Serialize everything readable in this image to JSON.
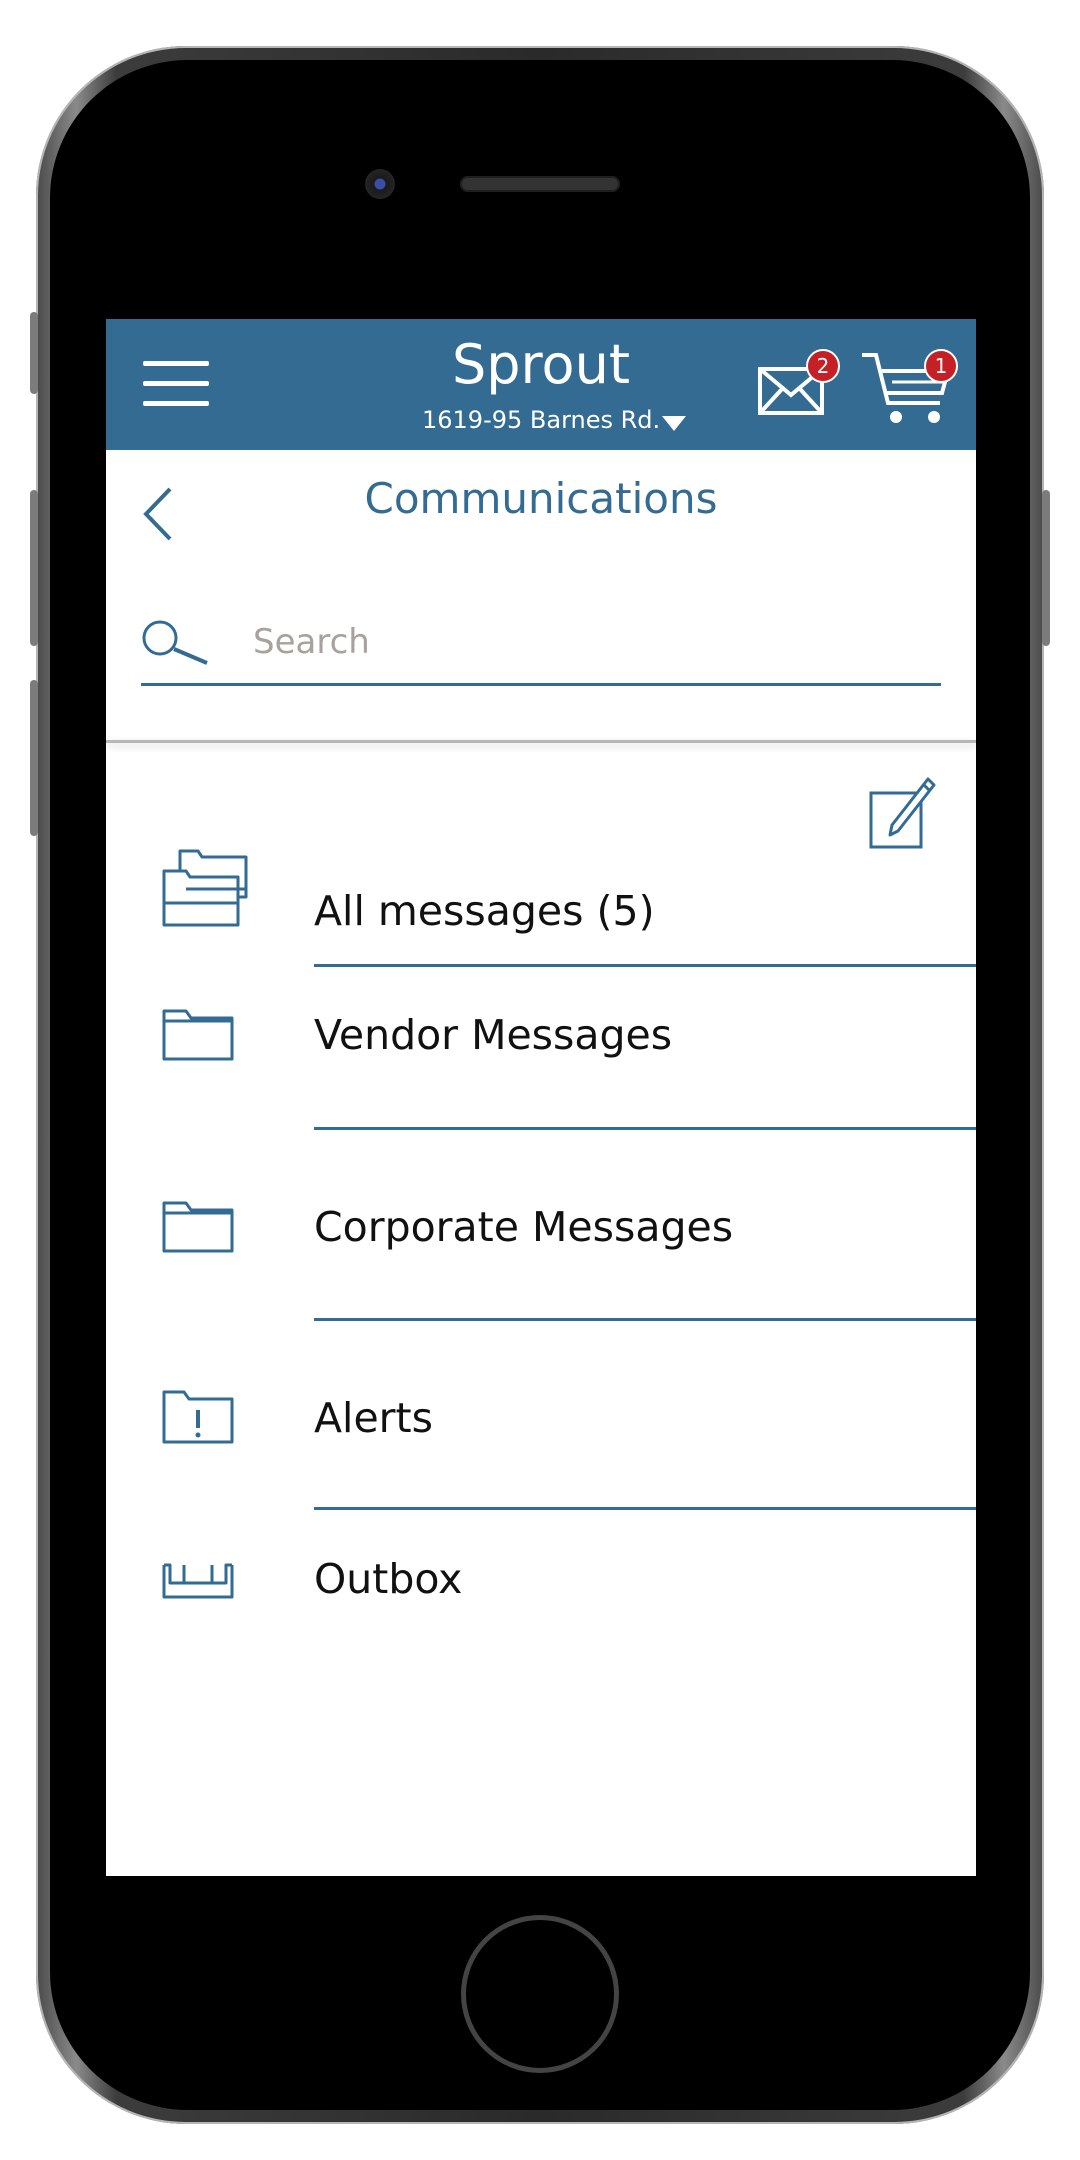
{
  "app": {
    "title": "Sprout",
    "location": "1619-95 Barnes Rd.",
    "mail_badge": "2",
    "cart_badge": "1",
    "colors": {
      "header": "#336b93",
      "badge": "#c62027",
      "accent": "#336b93"
    }
  },
  "page": {
    "title": "Communications"
  },
  "search": {
    "placeholder": "Search",
    "value": ""
  },
  "folders": [
    {
      "label": "All messages (5)",
      "icon": "folders-stack-icon"
    },
    {
      "label": "Vendor Messages",
      "icon": "folder-icon"
    },
    {
      "label": "Corporate Messages",
      "icon": "folder-icon"
    },
    {
      "label": "Alerts",
      "icon": "alert-folder-icon"
    },
    {
      "label": "Outbox",
      "icon": "outbox-tray-icon"
    }
  ]
}
